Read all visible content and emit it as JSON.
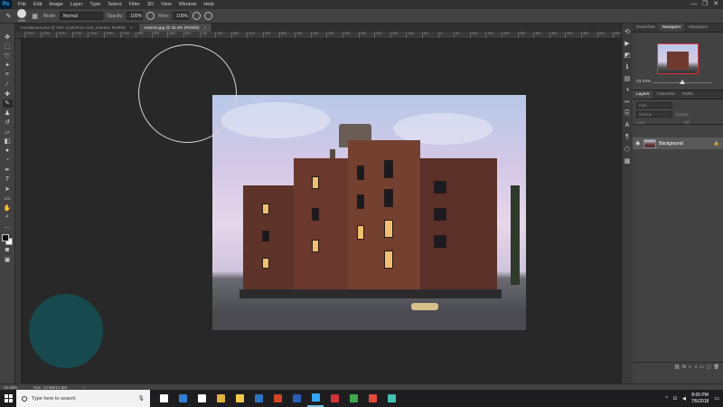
{
  "app": {
    "logo": "Ps"
  },
  "menu": [
    "File",
    "Edit",
    "Image",
    "Layer",
    "Type",
    "Select",
    "Filter",
    "3D",
    "View",
    "Window",
    "Help"
  ],
  "window_controls": [
    "—",
    "❐",
    "✕"
  ],
  "options": {
    "brush_size": "1000",
    "mode_label": "Mode:",
    "mode_value": "Normal",
    "opacity_label": "Opacity:",
    "opacity_value": "100%",
    "flow_label": "Flow:",
    "flow_value": "100%"
  },
  "tabs": [
    {
      "label": "moodboard.psd @ 25% (Catchmin.com_exterior, RGB/8)",
      "active": false
    },
    {
      "label": "exterior.jpg @ 33.3% (RGB/8)",
      "active": true
    }
  ],
  "ruler_ticks": [
    "1300",
    "1250",
    "1200",
    "1150",
    "1100",
    "1050",
    "1000",
    "950",
    "900",
    "850",
    "800",
    "750",
    "700",
    "650",
    "600",
    "550",
    "500",
    "450",
    "400",
    "350",
    "300",
    "250",
    "200",
    "150",
    "100",
    "50",
    "0",
    "50",
    "100",
    "150",
    "200",
    "250",
    "300",
    "350",
    "400",
    "450",
    "500",
    "550"
  ],
  "panels": {
    "top_tabs": [
      "Swatches",
      "Navigator",
      "Histogram"
    ],
    "active_top_tab": "Navigator",
    "zoom": "33.33%",
    "layer_tabs": [
      "Layers",
      "Channels",
      "Paths"
    ],
    "layer_kind": "Kind",
    "blend_mode": "Normal",
    "opacity_label": "Opacity:",
    "lock_label": "Lock:",
    "fill_label": "Fill:",
    "layers": [
      {
        "name": "Background",
        "locked": true
      }
    ],
    "footer_icons": [
      "⛓",
      "fx",
      "◐",
      "◑",
      "▭",
      "▢",
      "🗑"
    ]
  },
  "status": {
    "zoom": "33.33%",
    "doc": "Doc: 13.8M/13.8M"
  },
  "taskbar": {
    "search_placeholder": "Type here to search",
    "apps": [
      {
        "name": "task-view",
        "color": "#ffffff",
        "open": false
      },
      {
        "name": "edge",
        "color": "#2f7fd6",
        "open": false
      },
      {
        "name": "store",
        "color": "#ffffff",
        "open": false
      },
      {
        "name": "chrome",
        "color": "#e3b23c",
        "open": false
      },
      {
        "name": "file-explorer",
        "color": "#f2c94c",
        "open": false
      },
      {
        "name": "outlook",
        "color": "#2b72c2",
        "open": false
      },
      {
        "name": "powerpoint",
        "color": "#d04525",
        "open": false
      },
      {
        "name": "word",
        "color": "#2b5fb5",
        "open": false
      },
      {
        "name": "photoshop",
        "color": "#31a8ff",
        "open": true
      },
      {
        "name": "app-red",
        "color": "#d13438",
        "open": false
      },
      {
        "name": "camtasia",
        "color": "#3fa84a",
        "open": false
      },
      {
        "name": "app-red-2",
        "color": "#e24b3b",
        "open": false
      },
      {
        "name": "app-teal",
        "color": "#3fc3b3",
        "open": false
      }
    ],
    "time": "8:06 PM",
    "date": "7/5/2018"
  }
}
